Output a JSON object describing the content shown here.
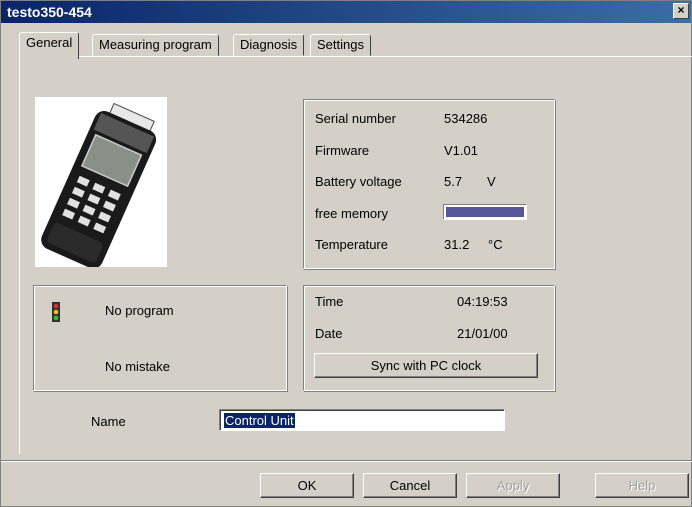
{
  "window": {
    "title": "testo350-454",
    "close_label": "×"
  },
  "tabs": [
    {
      "label": "General"
    },
    {
      "label": "Measuring program"
    },
    {
      "label": "Diagnosis"
    },
    {
      "label": "Settings"
    }
  ],
  "info": {
    "serial_label": "Serial number",
    "serial_value": "534286",
    "firmware_label": "Firmware",
    "firmware_value": "V1.01",
    "battery_label": "Battery voltage",
    "battery_value": "5.7",
    "battery_unit": "V",
    "memory_label": "free memory",
    "memory_fill_fraction": 1.0,
    "temp_label": "Temperature",
    "temp_value": "31.2",
    "temp_unit": "°C"
  },
  "status": {
    "program": "No program",
    "mistake": "No mistake"
  },
  "clock": {
    "time_label": "Time",
    "time_value": "04:19:53",
    "date_label": "Date",
    "date_value": "21/01/00",
    "sync_label": "Sync with PC clock"
  },
  "name": {
    "label": "Name",
    "value": "Control Unit"
  },
  "buttons": {
    "ok": "OK",
    "cancel": "Cancel",
    "apply": "Apply",
    "help": "Help"
  },
  "colors": {
    "title_bar": "#0a246a",
    "memory_bar": "#55559a",
    "face": "#d4d0c8"
  }
}
